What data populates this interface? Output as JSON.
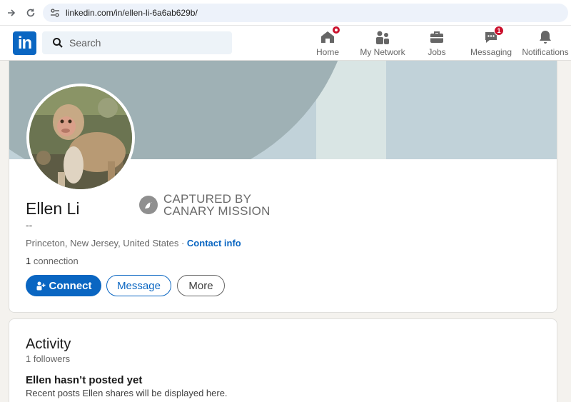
{
  "browser": {
    "url": "linkedin.com/in/ellen-li-6a6ab629b/"
  },
  "header": {
    "logo_text": "in",
    "search_placeholder": "Search",
    "nav": [
      {
        "label": "Home",
        "icon": "home-icon",
        "badge": ""
      },
      {
        "label": "My Network",
        "icon": "network-icon",
        "badge": ""
      },
      {
        "label": "Jobs",
        "icon": "briefcase-icon",
        "badge": ""
      },
      {
        "label": "Messaging",
        "icon": "messaging-icon",
        "badge": "1"
      },
      {
        "label": "Notifications",
        "icon": "bell-icon",
        "badge": ""
      }
    ]
  },
  "profile": {
    "name": "Ellen Li",
    "headline": "--",
    "location": "Princeton, New Jersey, United States",
    "separator": " · ",
    "contact_label": "Contact info",
    "connections_count": "1",
    "connections_label": " connection",
    "stamp_line1": "CAPTURED BY",
    "stamp_line2": "CANARY MISSION",
    "buttons": {
      "connect": "Connect",
      "message": "Message",
      "more": "More"
    }
  },
  "activity": {
    "title": "Activity",
    "followers": "1 followers",
    "empty_title": "Ellen hasn’t posted yet",
    "empty_sub": "Recent posts Ellen shares will be displayed here."
  },
  "colors": {
    "brand": "#0a66c2",
    "badge": "#cb112d"
  }
}
